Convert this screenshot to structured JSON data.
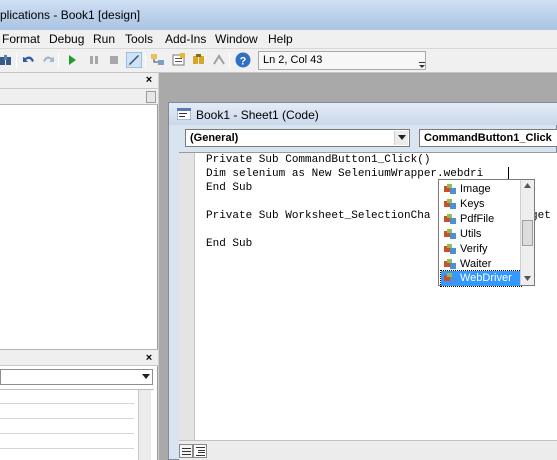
{
  "window": {
    "title": "plications - Book1 [design]"
  },
  "menu": [
    "Format",
    "Debug",
    "Run",
    "Tools",
    "Add-Ins",
    "Window",
    "Help"
  ],
  "toolbar": {
    "status_text": "Ln 2, Col 43",
    "icons": [
      "binoculars-icon",
      "undo-icon",
      "redo-icon",
      "run-icon",
      "break-icon",
      "reset-icon",
      "design-mode-icon",
      "project-explorer-icon",
      "properties-icon",
      "object-browser-icon",
      "toolbox-icon",
      "help-icon"
    ]
  },
  "left_panels": {
    "top_close": "×",
    "bottom_close": "×"
  },
  "code_window": {
    "title": "Book1 - Sheet1 (Code)",
    "object_combo": "(General)",
    "procedure_combo": "CommandButton1_Click",
    "lines": [
      "Private Sub CommandButton1_Click()",
      "Dim selenium as New SeleniumWrapper.webdri",
      "End Sub",
      "",
      "Private Sub Worksheet_SelectionCha",
      "",
      "End Sub"
    ],
    "line5_tail": "get"
  },
  "intellisense": {
    "items": [
      "Image",
      "Keys",
      "PdfFile",
      "Utils",
      "Verify",
      "Waiter",
      "WebDriver"
    ],
    "selected": "WebDriver"
  },
  "colors": {
    "selection": "#3399ff",
    "editor_bg": "#ffffff",
    "mdi_bg": "#a9a9a9"
  }
}
